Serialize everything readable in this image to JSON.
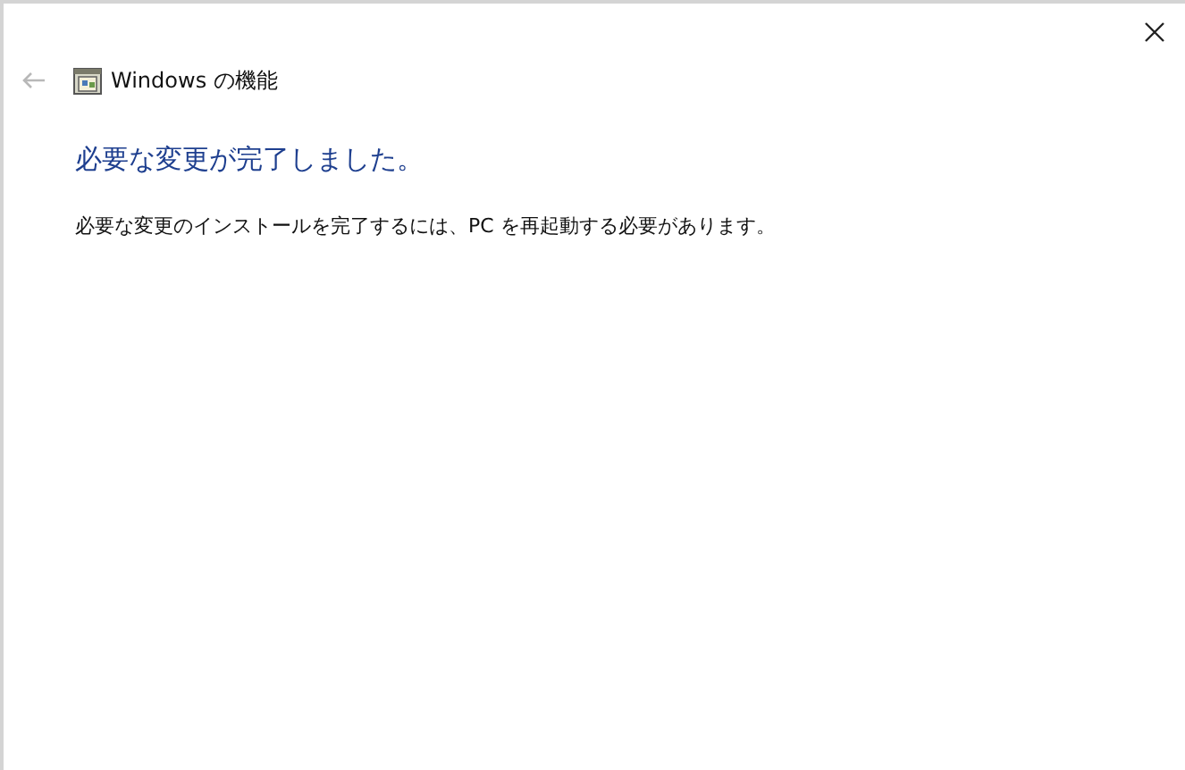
{
  "window": {
    "title": "Windows の機能",
    "back_disabled": true
  },
  "heading": "必要な変更が完了しました。",
  "message": "必要な変更のインストールを完了するには、PC を再起動する必要があります。"
}
